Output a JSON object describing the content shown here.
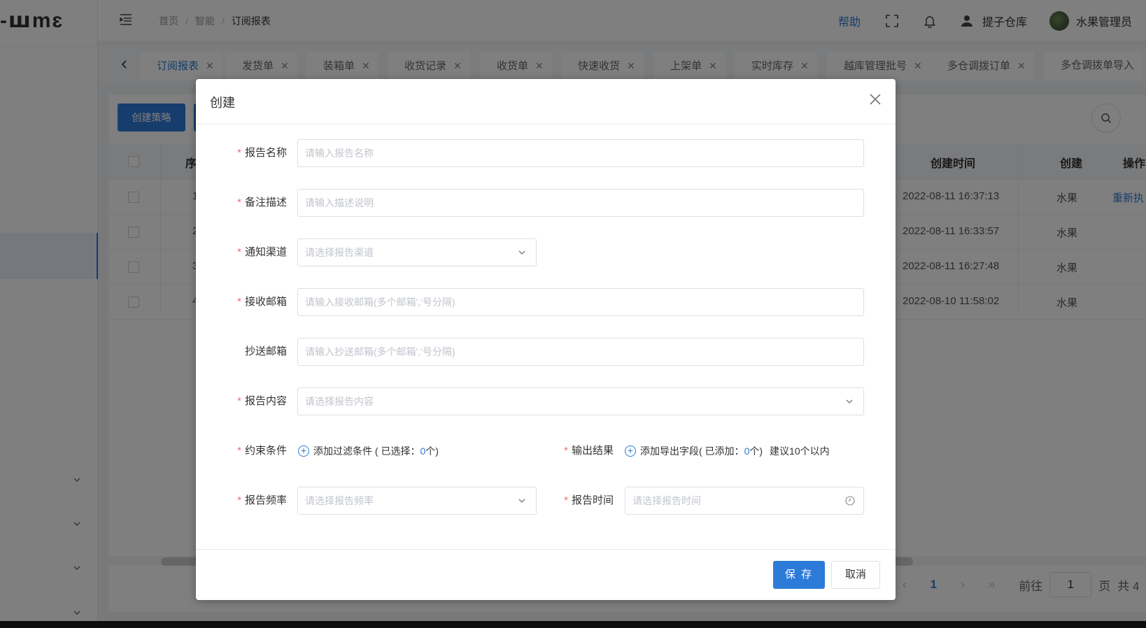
{
  "app": {
    "logo": "-ꟺmɛ"
  },
  "header": {
    "breadcrumb": [
      "首页",
      "智能",
      "订阅报表"
    ],
    "help": "帮助",
    "warehouse": "提子仓库",
    "user": "水果管理员"
  },
  "tabs": [
    {
      "label": "订阅报表",
      "active": true
    },
    {
      "label": "发货单"
    },
    {
      "label": "装箱单"
    },
    {
      "label": "收货记录"
    },
    {
      "label": "收货单"
    },
    {
      "label": "快速收货"
    },
    {
      "label": "上架单"
    },
    {
      "label": "实时库存"
    },
    {
      "label": "越库管理批号"
    },
    {
      "label": "多仓调拨订单"
    },
    {
      "label": "多仓调拨单导入"
    }
  ],
  "toolbar": {
    "create_strategy": "创建策略"
  },
  "table": {
    "headers": {
      "seq": "序",
      "created_time": "创建时间",
      "creator": "创建",
      "action": "操作"
    },
    "rows": [
      {
        "seq": "1",
        "created_time": "2022-08-11 16:37:13",
        "creator": "水果",
        "action": "重新执"
      },
      {
        "seq": "2",
        "created_time": "2022-08-11 16:33:57",
        "creator": "水果",
        "action": ""
      },
      {
        "seq": "3",
        "created_time": "2022-08-11 16:27:48",
        "creator": "水果",
        "action": ""
      },
      {
        "seq": "4",
        "created_time": "2022-08-10 11:58:02",
        "creator": "水果",
        "action": ""
      }
    ]
  },
  "pager": {
    "current": "1",
    "goto_label": "前往",
    "goto_value": "1",
    "page_unit": "页",
    "total_prefix": "共 4"
  },
  "dialog": {
    "title": "创建",
    "fields": {
      "report_name": {
        "label": "报告名称",
        "placeholder": "请输入报告名称"
      },
      "remark": {
        "label": "备注描述",
        "placeholder": "请输入描述说明"
      },
      "channel": {
        "label": "通知渠道",
        "placeholder": "请选择报告渠道"
      },
      "recv_email": {
        "label": "接收邮箱",
        "placeholder": "请输入接收邮箱(多个邮箱','号分隔)"
      },
      "cc_email": {
        "label": "抄送邮箱",
        "placeholder": "请输入抄送邮箱(多个邮箱','号分隔)"
      },
      "content": {
        "label": "报告内容",
        "placeholder": "请选择报告内容"
      },
      "constraint": {
        "label": "约束条件",
        "add_text": "添加过滤条件 ( 已选择：",
        "count": "0",
        "suffix": "个)"
      },
      "output": {
        "label": "输出结果",
        "add_text": "添加导出字段( 已添加：",
        "count": "0",
        "suffix": "个)",
        "hint": "建议10个以内"
      },
      "frequency": {
        "label": "报告频率",
        "placeholder": "请选择报告频率"
      },
      "time": {
        "label": "报告时间",
        "placeholder": "请选择报告时间"
      }
    },
    "save": "保 存",
    "cancel": "取消"
  },
  "colors": {
    "primary": "#2d7bd8",
    "required": "#f56c6c"
  }
}
